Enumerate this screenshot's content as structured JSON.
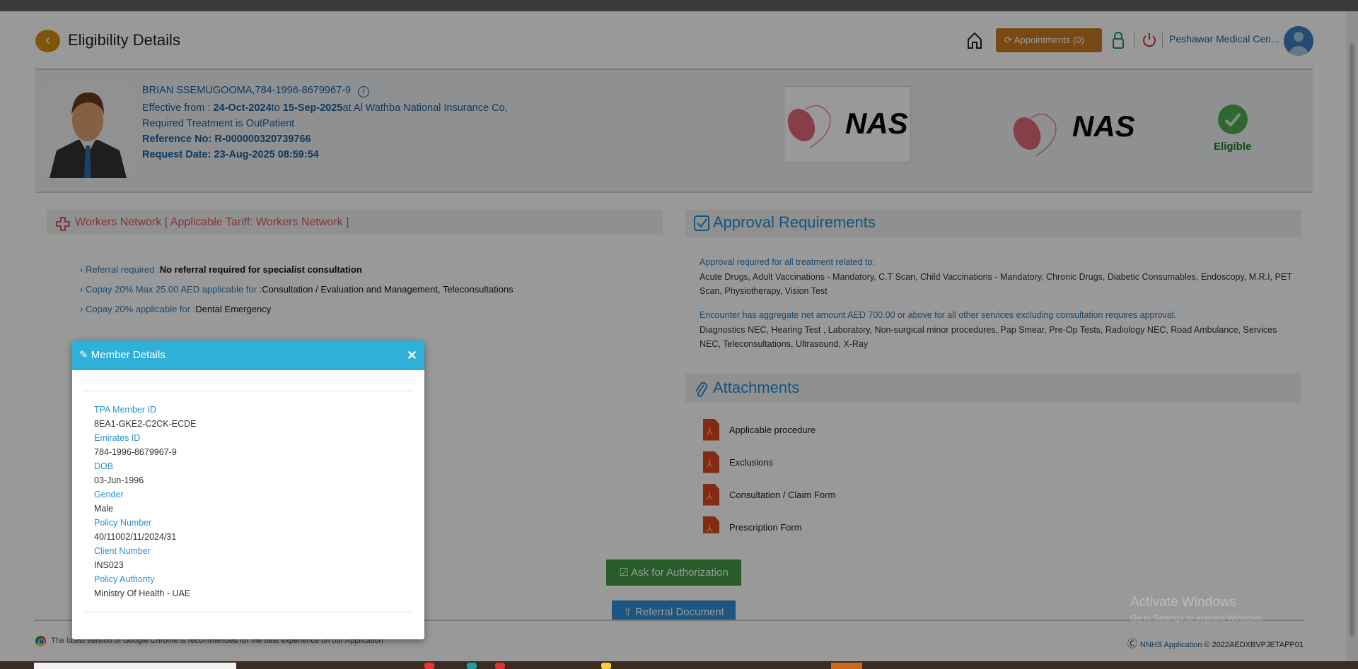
{
  "header": {
    "title": "Eligibility Details",
    "appointments_label": "Appointments (0)",
    "organization": "Peshawar Medical Cen..."
  },
  "member": {
    "name_line": "BRIAN SSEMUGOOMA,",
    "emirates_id": "784-1996-8679967-9",
    "effective_prefix": "Effective from : ",
    "effective_from": "24-Oct-2024",
    "to_label": "to ",
    "effective_to": "15-Sep-2025",
    "insurer": "at Al Wathba National Insurance Co,",
    "treatment": "Required Treatment is OutPatient",
    "reference": "Reference No: R-000000320739766",
    "request_date": "Request Date: 23-Aug-2025 08:59:54"
  },
  "logos": {
    "payer_logo_text": "NAS",
    "tpa_logo_text": "NAS"
  },
  "status": {
    "label": "Eligible",
    "color": "#4fae4f"
  },
  "network": {
    "title": "Workers Network [ Applicable Tariff: Workers Network ]",
    "items": [
      {
        "key": "Referral required :",
        "value": "No referral required for specialist consultation"
      },
      {
        "key": "Copay 20% Max 25.00 AED applicable for :",
        "value": "Consultation / Evaluation and Management, Teleconsultations"
      },
      {
        "key": "Copay 20% applicable for :",
        "value": "Dental Emergency"
      }
    ]
  },
  "approval": {
    "title": "Approval Requirements",
    "blocks": [
      {
        "heading": "Approval required for all treatment related to:",
        "text": "Acute Drugs, Adult Vaccinations - Mandatory, C.T Scan, Child Vaccinations - Mandatory, Chronic Drugs, Diabetic Consumables, Endoscopy, M.R.I, PET Scan, Physiotherapy, Vision Test"
      },
      {
        "heading": "Encounter has aggregate net amount AED 700.00 or above for all other services excluding consultation requires approval.",
        "text": "Diagnostics NEC, Hearing Test , Laboratory, Non-surgical minor procedures, Pap Smear, Pre-Op Tests, Radiology NEC, Road Ambulance, Services NEC, Teleconsultations, Ultrasound, X-Ray"
      }
    ]
  },
  "attachments": {
    "title": "Attachments",
    "items": [
      "Applicable procedure",
      "Exclusions",
      "Consultation / Claim Form",
      "Prescription Form"
    ]
  },
  "actions": {
    "ask_authorization": "Ask for Authorization",
    "referral_document": "Referral Document"
  },
  "footer": {
    "browser_note": "The latest version of Google Chrome is recommended for the best experience on our Application",
    "app_name": "NNHS Application",
    "copyright": "© 2022AEDXBVPJETAPP01"
  },
  "watermark": {
    "title": "Activate Windows",
    "subtitle": "Go to Settings to activate Windows."
  },
  "modal": {
    "title": "Member Details",
    "fields": [
      {
        "label": "TPA Member ID",
        "value": "8EA1-GKE2-C2CK-ECDE"
      },
      {
        "label": "Emirates ID",
        "value": "784-1996-8679967-9"
      },
      {
        "label": "DOB",
        "value": "03-Jun-1996"
      },
      {
        "label": "Gender",
        "value": "Male"
      },
      {
        "label": "Policy Number",
        "value": "40/11002/11/2024/31"
      },
      {
        "label": "Client Number",
        "value": "INS023"
      },
      {
        "label": "Policy Authority",
        "value": "Ministry Of Health - UAE"
      }
    ]
  }
}
